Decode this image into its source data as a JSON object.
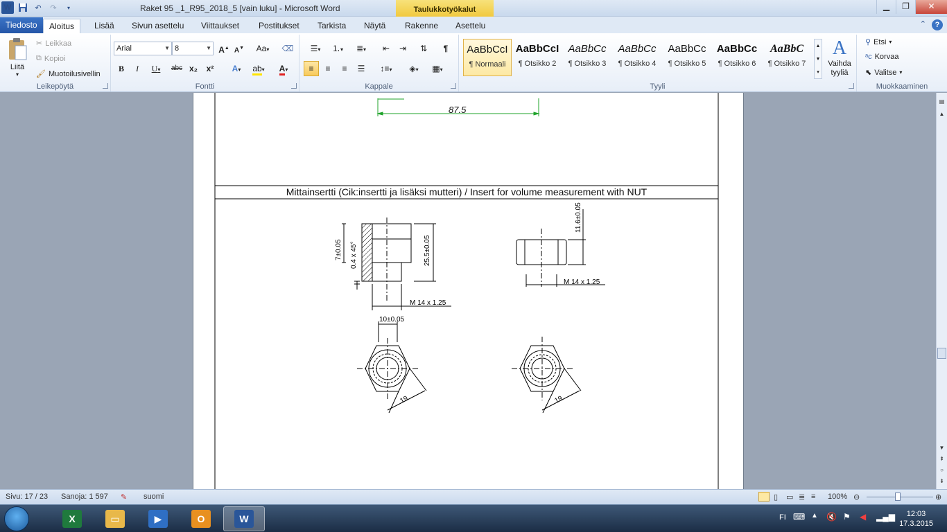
{
  "window": {
    "title": "Raket 95 _1_R95_2018_5 [vain luku]  -  Microsoft Word",
    "context_tab_header": "Taulukkotyökalut"
  },
  "tabs": [
    "Tiedosto",
    "Aloitus",
    "Lisää",
    "Sivun asettelu",
    "Viittaukset",
    "Postitukset",
    "Tarkista",
    "Näytä",
    "Rakenne",
    "Asettelu"
  ],
  "active_tab": "Aloitus",
  "clipboard": {
    "paste": "Liitä",
    "cut": "Leikkaa",
    "copy": "Kopioi",
    "format_painter": "Muotoilusivellin",
    "label": "Leikepöytä"
  },
  "font": {
    "name": "Arial",
    "size": "8",
    "label": "Fontti",
    "bold": "B",
    "italic": "I",
    "underline": "U",
    "strike": "abc",
    "sub": "x₂",
    "sup": "x²",
    "grow": "A",
    "shrink": "A",
    "case": "Aa"
  },
  "paragraph": {
    "label": "Kappale",
    "pilcrow": "¶"
  },
  "styles": {
    "label": "Tyyli",
    "items": [
      {
        "sample": "AaBbCcI",
        "name": "¶ Normaali"
      },
      {
        "sample": "AaBbCcI",
        "name": "¶ Otsikko 2"
      },
      {
        "sample": "AaBbCc",
        "name": "¶ Otsikko 3"
      },
      {
        "sample": "AaBbCc",
        "name": "¶ Otsikko 4"
      },
      {
        "sample": "AaBbCc",
        "name": "¶ Otsikko 5"
      },
      {
        "sample": "AaBbCc",
        "name": "¶ Otsikko 6"
      },
      {
        "sample": "AaBbC",
        "name": "¶ Otsikko 7"
      }
    ],
    "change_styles": "Vaihda tyyliä"
  },
  "editing": {
    "label": "Muokkaaminen",
    "find": "Etsi",
    "replace": "Korvaa",
    "select": "Valitse"
  },
  "document": {
    "top_dimension": "87.5",
    "caption": "Mittainsertti  (Cik:insertti ja lisäksi mutteri) / Insert for volume measurement with NUT",
    "insert_dims": {
      "left_small": "7±0.05",
      "chamfer": "0.4 x 45°",
      "height": "25.5±0.05",
      "thread": "M 14 x 1.25",
      "width_flat": "10±0.05",
      "across_flats": "19"
    },
    "nut_dims": {
      "height": "11.6±0.05",
      "thread": "M 14 x 1.25",
      "across_flats": "19"
    }
  },
  "statusbar": {
    "page": "Sivu: 17 / 23",
    "words": "Sanoja: 1 597",
    "language": "suomi",
    "zoom": "100%",
    "zoom_fraction": 0.5
  },
  "taskbar": {
    "apps": [
      "excel",
      "explorer",
      "media-player",
      "outlook",
      "word"
    ],
    "lang": "FI",
    "time": "12:03",
    "date": "17.3.2015"
  }
}
